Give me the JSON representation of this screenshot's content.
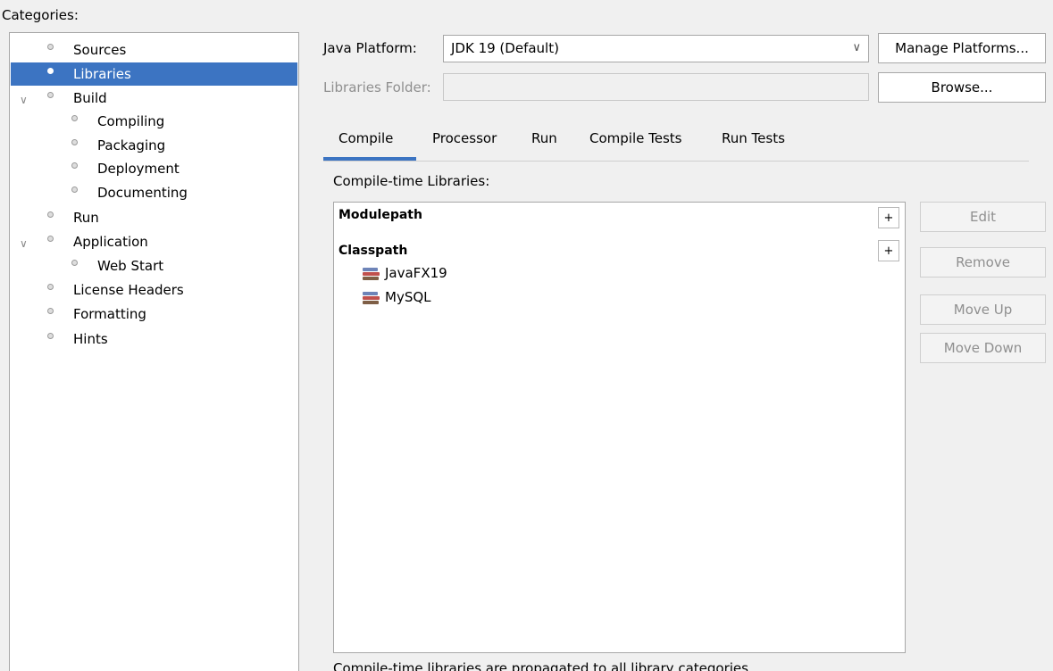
{
  "categories": {
    "label": "Categories:",
    "items": [
      {
        "label": "Sources"
      },
      {
        "label": "Libraries"
      },
      {
        "label": "Build"
      },
      {
        "label": "Compiling"
      },
      {
        "label": "Packaging"
      },
      {
        "label": "Deployment"
      },
      {
        "label": "Documenting"
      },
      {
        "label": "Run"
      },
      {
        "label": "Application"
      },
      {
        "label": "Web Start"
      },
      {
        "label": "License Headers"
      },
      {
        "label": "Formatting"
      },
      {
        "label": "Hints"
      }
    ],
    "selected": "Libraries"
  },
  "platform": {
    "label": "Java Platform:",
    "value": "JDK 19 (Default)",
    "manage_label": "Manage Platforms..."
  },
  "libraries_folder": {
    "label": "Libraries Folder:",
    "value": "",
    "browse_label": "Browse..."
  },
  "tabs": [
    {
      "label": "Compile"
    },
    {
      "label": "Processor"
    },
    {
      "label": "Run"
    },
    {
      "label": "Compile Tests"
    },
    {
      "label": "Run Tests"
    }
  ],
  "active_tab": "Compile",
  "compile": {
    "heading": "Compile-time Libraries:",
    "modulepath_title": "Modulepath",
    "classpath_title": "Classpath",
    "add_symbol": "+",
    "classpath_entries": [
      {
        "label": "JavaFX19"
      },
      {
        "label": "MySQL"
      }
    ],
    "buttons": {
      "edit": "Edit",
      "remove": "Remove",
      "move_up": "Move Up",
      "move_down": "Move Down"
    },
    "footer_note": "Compile-time libraries are propagated to all library categories."
  },
  "colors": {
    "selection": "#3c74c2",
    "panel_bg": "#f0f0f0"
  }
}
